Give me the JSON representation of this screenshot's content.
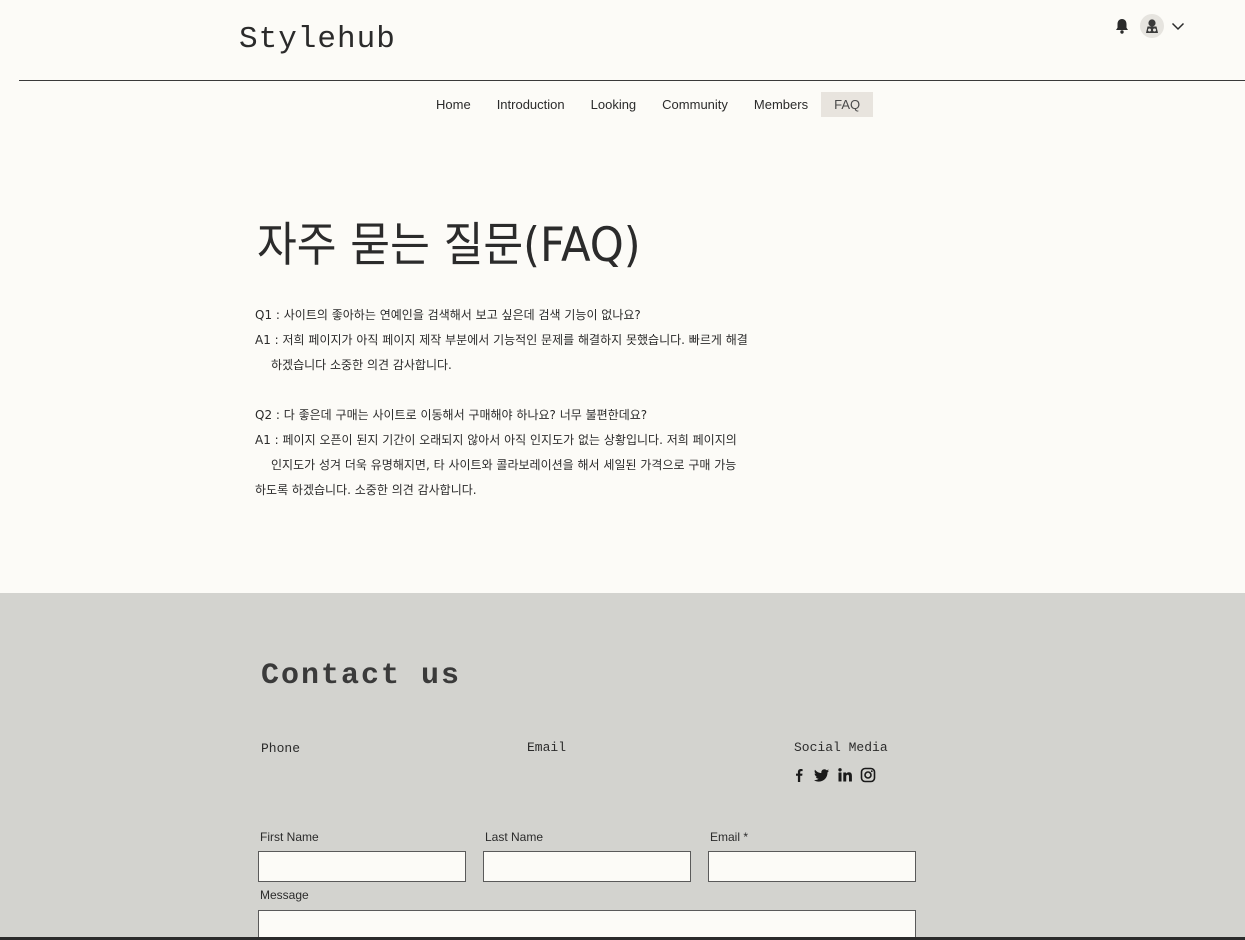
{
  "header": {
    "brand": "Stylehub",
    "icons": [
      "bell-icon",
      "avatar",
      "chevron-down-icon"
    ]
  },
  "nav": {
    "items": [
      "Home",
      "Introduction",
      "Looking",
      "Community",
      "Members",
      "FAQ"
    ],
    "active": "FAQ"
  },
  "faq": {
    "title": "자주 묻는 질문(FAQ)",
    "lines": [
      "Q1 : 사이트의 좋아하는 연예인을 검색해서 보고 싶은데 검색 기능이 없나요?",
      "A1 : 저희 페이지가 아직 페이지 제작 부분에서 기능적인 문제를 해결하지 못했습니다. 빠르게 해결",
      "하겠습니다 소중한 의견 감사합니다.",
      "Q2 : 다 좋은데 구매는 사이트로 이동해서 구매해야 하나요? 너무 불편한데요?",
      "A1 : 페이지 오픈이 된지 기간이 오래되지 않아서 아직 인지도가 없는 상황입니다. 저희 페이지의",
      "인지도가 성겨 더욱 유명해지면, 타 사이트와 콜라보레이션을 해서 세일된 가격으로 구매 가능",
      "하도록 하겠습니다. 소중한 의견 감사합니다."
    ]
  },
  "contact": {
    "title": "Contact us",
    "phone_label": "Phone",
    "email_label": "Email",
    "social_label": "Social Media",
    "socials": [
      "facebook-icon",
      "twitter-icon",
      "linkedin-icon",
      "instagram-icon"
    ],
    "form": {
      "first_name_label": "First Name",
      "last_name_label": "Last Name",
      "email_label": "Email *",
      "message_label": "Message",
      "first_name_value": "",
      "last_name_value": "",
      "email_value": "",
      "message_value": ""
    }
  },
  "colors": {
    "background": "#fcfbf7",
    "footer": "#d3d3cf",
    "nav_active_bg": "#e8e4de",
    "text": "#2b2b2b"
  }
}
